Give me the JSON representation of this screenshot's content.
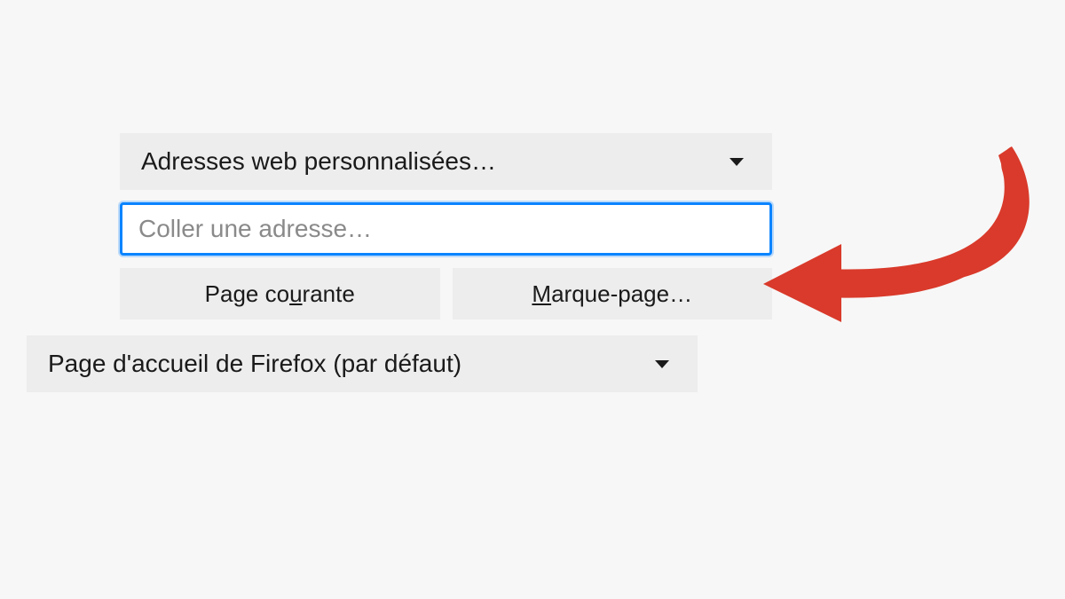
{
  "dropdown1": {
    "label": "Adresses web personnalisées…"
  },
  "url_input": {
    "placeholder": "Coller une adresse…",
    "value": ""
  },
  "buttons": {
    "current_page": {
      "pre": "Page co",
      "u": "u",
      "post": "rante"
    },
    "bookmark": {
      "pre": "",
      "u": "M",
      "post": "arque-page…"
    }
  },
  "dropdown2": {
    "label": "Page d'accueil de Firefox (par défaut)"
  },
  "colors": {
    "accent": "#0a84ff",
    "arrow": "#d93a2b"
  }
}
